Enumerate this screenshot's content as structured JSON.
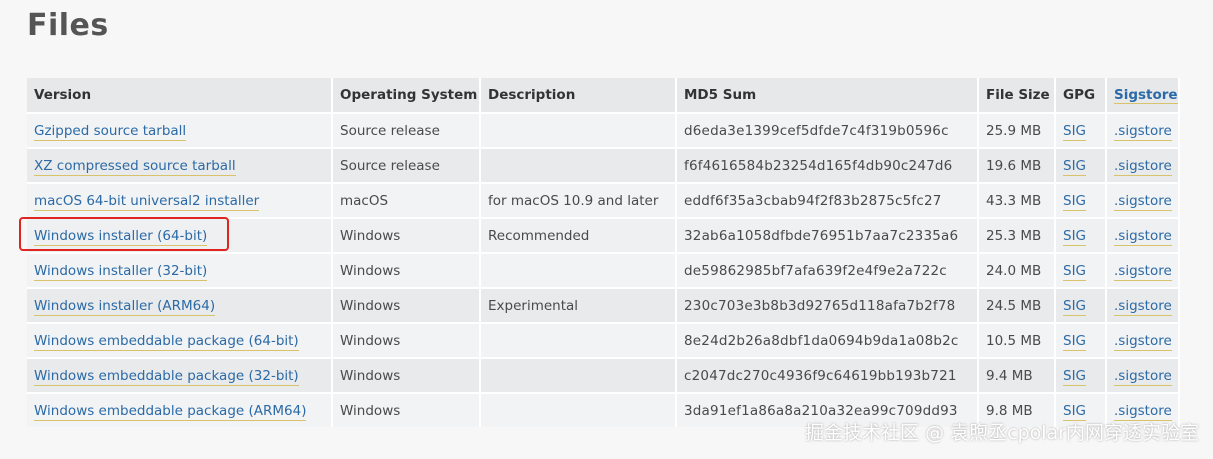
{
  "page": {
    "title": "Files"
  },
  "table": {
    "headers": {
      "version": "Version",
      "os": "Operating System",
      "description": "Description",
      "md5": "MD5 Sum",
      "size": "File Size",
      "gpg": "GPG",
      "sigstore": "Sigstore"
    },
    "rows": [
      {
        "version": "Gzipped source tarball",
        "os": "Source release",
        "description": "",
        "md5": "d6eda3e1399cef5dfde7c4f319b0596c",
        "size": "25.9 MB",
        "gpg": "SIG",
        "sigstore": ".sigstore"
      },
      {
        "version": "XZ compressed source tarball",
        "os": "Source release",
        "description": "",
        "md5": "f6f4616584b23254d165f4db90c247d6",
        "size": "19.6 MB",
        "gpg": "SIG",
        "sigstore": ".sigstore"
      },
      {
        "version": "macOS 64-bit universal2 installer",
        "os": "macOS",
        "description": "for macOS 10.9 and later",
        "md5": "eddf6f35a3cbab94f2f83b2875c5fc27",
        "size": "43.3 MB",
        "gpg": "SIG",
        "sigstore": ".sigstore"
      },
      {
        "version": "Windows installer (64-bit)",
        "os": "Windows",
        "description": "Recommended",
        "md5": "32ab6a1058dfbde76951b7aa7c2335a6",
        "size": "25.3 MB",
        "gpg": "SIG",
        "sigstore": ".sigstore"
      },
      {
        "version": "Windows installer (32-bit)",
        "os": "Windows",
        "description": "",
        "md5": "de59862985bf7afa639f2e4f9e2a722c",
        "size": "24.0 MB",
        "gpg": "SIG",
        "sigstore": ".sigstore"
      },
      {
        "version": "Windows installer (ARM64)",
        "os": "Windows",
        "description": "Experimental",
        "md5": "230c703e3b8b3d92765d118afa7b2f78",
        "size": "24.5 MB",
        "gpg": "SIG",
        "sigstore": ".sigstore"
      },
      {
        "version": "Windows embeddable package (64-bit)",
        "os": "Windows",
        "description": "",
        "md5": "8e24d2b26a8dbf1da0694b9da1a08b2c",
        "size": "10.5 MB",
        "gpg": "SIG",
        "sigstore": ".sigstore"
      },
      {
        "version": "Windows embeddable package (32-bit)",
        "os": "Windows",
        "description": "",
        "md5": "c2047dc270c4936f9c64619bb193b721",
        "size": "9.4 MB",
        "gpg": "SIG",
        "sigstore": ".sigstore"
      },
      {
        "version": "Windows embeddable package (ARM64)",
        "os": "Windows",
        "description": "",
        "md5": "3da91ef1a86a8a210a32ea99c709dd93",
        "size": "9.8 MB",
        "gpg": "SIG",
        "sigstore": ".sigstore"
      }
    ]
  },
  "watermark": {
    "text": "掘金技术社区 @ 袁煦丞cpolar内网穿透实验室"
  },
  "colors": {
    "link": "#2b6aa6",
    "highlight_box": "#e0241f",
    "header_bg": "#e6e8ea"
  }
}
